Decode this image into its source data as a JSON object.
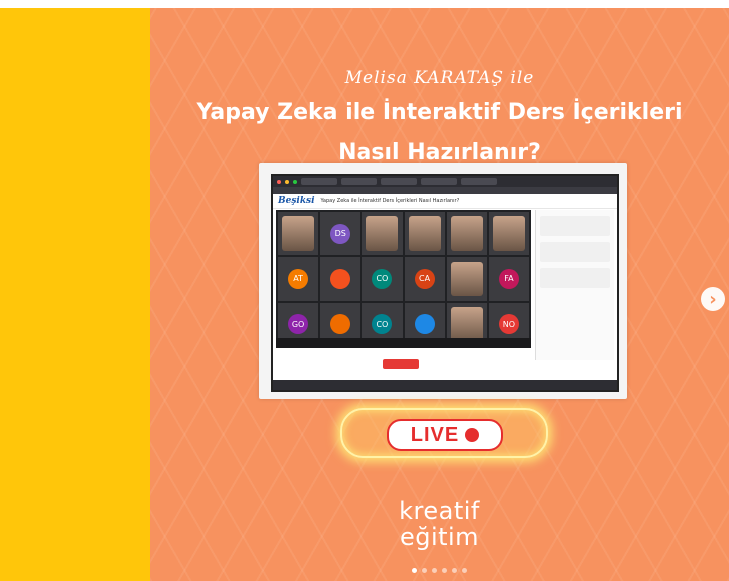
{
  "post": {
    "author": "Melisa KARATAŞ ile",
    "title_line1": "Yapay Zeka ile İnteraktif Ders İçerikleri",
    "title_line2": "Nasıl Hazırlanır?",
    "live_label": "LIVE",
    "logo_line1": "kreatif",
    "logo_line2": "eğitim",
    "pager": {
      "count": 6,
      "active_index": 0
    }
  },
  "screenshot": {
    "brand": "Beşiksi",
    "window_title": "Yapay Zeka ile İnteraktif Ders İçerikleri Nasıl Hazırlanır?",
    "participants": [
      "DS",
      "AT",
      "CO",
      "CO",
      "CA",
      "FA",
      "GO",
      "NO"
    ]
  },
  "colors": {
    "background_orange": "#f7925f",
    "side_yellow": "#ffc60a",
    "live_red": "#e52d2d"
  },
  "icons": {
    "next": "chevron-right-icon"
  }
}
